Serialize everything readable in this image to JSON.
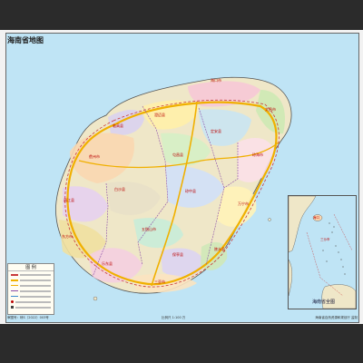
{
  "map": {
    "title": "海南省地图",
    "legend_title": "图 例",
    "inset_title": "海南省全图",
    "footer_left": "审图号：琼S（2022）003号",
    "footer_mid": "比例尺 1:100 万",
    "footer_right": "海南省自然资源和规划厅 监制",
    "cities": [
      {
        "name": "海口市"
      },
      {
        "name": "文昌市"
      },
      {
        "name": "琼海市"
      },
      {
        "name": "万宁市"
      },
      {
        "name": "陵水县"
      },
      {
        "name": "三亚市"
      },
      {
        "name": "乐东县"
      },
      {
        "name": "东方市"
      },
      {
        "name": "昌江县"
      },
      {
        "name": "儋州市"
      },
      {
        "name": "临高县"
      },
      {
        "name": "澄迈县"
      },
      {
        "name": "定安县"
      },
      {
        "name": "屯昌县"
      },
      {
        "name": "琼中县"
      },
      {
        "name": "五指山市"
      },
      {
        "name": "保亭县"
      },
      {
        "name": "白沙县"
      }
    ],
    "inset_cities": [
      {
        "name": "海口"
      },
      {
        "name": "三沙市"
      }
    ],
    "colors": {
      "sea": "#bfe4f5",
      "road": "#f0b000",
      "rail": "#c83a3a",
      "boundary": "#8a4ca8"
    }
  }
}
